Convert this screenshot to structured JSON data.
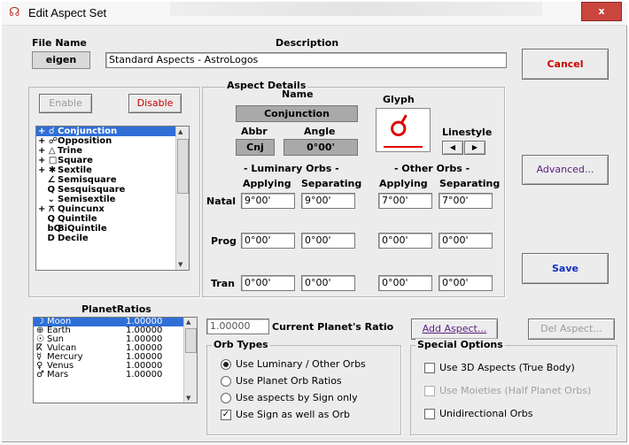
{
  "window": {
    "title": "Edit Aspect Set",
    "close": "x"
  },
  "file": {
    "label": "File Name",
    "value": "eigen"
  },
  "description": {
    "label": "Description",
    "value": "Standard Aspects - AstroLogos"
  },
  "buttons": {
    "cancel": "Cancel",
    "enable": "Enable",
    "disable": "Disable",
    "advanced": "Advanced...",
    "save": "Save",
    "add_aspect": "Add Aspect...",
    "del_aspect": "Del Aspect..."
  },
  "aspect_list": [
    {
      "prefix": "+ ☌",
      "name": "Conjunction",
      "selected": true
    },
    {
      "prefix": "+ ☍",
      "name": "Opposition"
    },
    {
      "prefix": "+ △",
      "name": "Trine"
    },
    {
      "prefix": "+ □",
      "name": "Square"
    },
    {
      "prefix": "+ ✱",
      "name": "Sextile"
    },
    {
      "prefix": "   ∠",
      "name": "Semisquare"
    },
    {
      "prefix": "   Q",
      "name": "Sesquisquare"
    },
    {
      "prefix": "   ⌄",
      "name": "Semisextile"
    },
    {
      "prefix": "+ ⚻",
      "name": "Quincunx"
    },
    {
      "prefix": "   Q",
      "name": "Quintile"
    },
    {
      "prefix": "   bQ",
      "name": "BiQuintile"
    },
    {
      "prefix": "   D",
      "name": "Decile"
    }
  ],
  "details": {
    "group": "Aspect Details",
    "name_label": "Name",
    "name_value": "Conjunction",
    "abbr_label": "Abbr",
    "abbr_value": "Cnj",
    "angle_label": "Angle",
    "angle_value": "0°00'",
    "glyph_label": "Glyph",
    "glyph_value": "☌",
    "linestyle_label": "Linestyle",
    "line_left": "◀",
    "line_right": "▶",
    "luminary_orbs": "- Luminary Orbs -",
    "other_orbs": "- Other Orbs -",
    "applying": "Applying",
    "separating": "Separating",
    "rows": [
      {
        "label": "Natal",
        "values": [
          "9°00'",
          "9°00'",
          "7°00'",
          "7°00'"
        ]
      },
      {
        "label": "Prog",
        "values": [
          "0°00'",
          "0°00'",
          "0°00'",
          "0°00'"
        ]
      },
      {
        "label": "Tran",
        "values": [
          "0°00'",
          "0°00'",
          "0°00'",
          "0°00'"
        ]
      }
    ]
  },
  "planet_ratios": {
    "label": "PlanetRatios",
    "items": [
      {
        "sym": "☽",
        "name": "Moon",
        "value": "1.00000",
        "selected": true
      },
      {
        "sym": "⊕",
        "name": "Earth",
        "value": "1.00000"
      },
      {
        "sym": "☉",
        "name": "Sun",
        "value": "1.00000"
      },
      {
        "sym": "ⴽ",
        "name": "Vulcan",
        "value": "1.00000"
      },
      {
        "sym": "☿",
        "name": "Mercury",
        "value": "1.00000"
      },
      {
        "sym": "♀",
        "name": "Venus",
        "value": "1.00000"
      },
      {
        "sym": "♂",
        "name": "Mars",
        "value": "1.00000"
      }
    ],
    "current_value": "1.00000",
    "current_label": "Current Planet's Ratio"
  },
  "orb_types": {
    "label": "Orb Types",
    "options": [
      {
        "text": "Use Luminary / Other Orbs",
        "checked": true
      },
      {
        "text": "Use Planet Orb Ratios",
        "checked": false
      },
      {
        "text": "Use aspects by Sign only",
        "checked": false
      }
    ],
    "checkbox": {
      "text": "Use Sign as well as Orb",
      "checked": true
    }
  },
  "special_options": {
    "label": "Special Options",
    "items": [
      {
        "text": "Use 3D Aspects (True Body)",
        "enabled": true
      },
      {
        "text": "Use Moieties (Half Planet Orbs)",
        "enabled": false
      },
      {
        "text": "Unidirectional Orbs",
        "enabled": true
      }
    ]
  }
}
